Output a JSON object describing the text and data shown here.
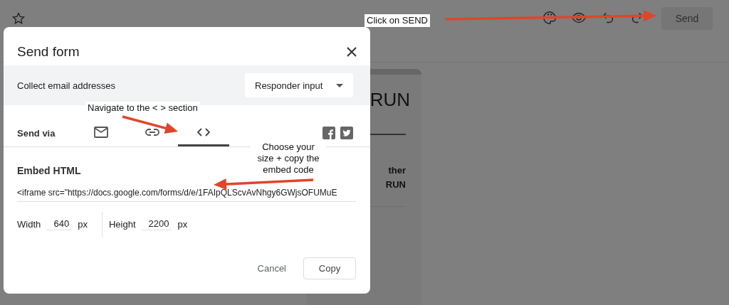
{
  "toolbar": {
    "send_button": {
      "label": "Send",
      "disabled": true
    }
  },
  "form_card": {
    "title_fragment": "RUN",
    "lines": [
      "ther",
      "RUN"
    ]
  },
  "dialog": {
    "title": "Send form",
    "collect_email": {
      "label": "Collect email addresses",
      "value": "Responder input"
    },
    "send_via": {
      "label": "Send via",
      "tabs": [
        {
          "kind": "email",
          "selected": false
        },
        {
          "kind": "link",
          "selected": false
        },
        {
          "kind": "embed",
          "selected": true
        }
      ]
    },
    "section_title": "Embed HTML",
    "embed_code": "<iframe src=\"https://docs.google.com/forms/d/e/1FAIpQLScvAvNhgy6GWjsOFUMuE",
    "size_fields": [
      {
        "label": "Width",
        "value": "640",
        "unit": "px"
      },
      {
        "label": "Height",
        "value": "2200",
        "unit": "px"
      }
    ],
    "buttons": [
      {
        "kind": "cancel",
        "label": "Cancel"
      },
      {
        "kind": "copy",
        "label": "Copy"
      }
    ]
  },
  "annotations": [
    {
      "text": "Click on SEND"
    },
    {
      "text": "Navigate to the < > section"
    },
    {
      "text": "Choose your size + copy the embed code"
    }
  ]
}
